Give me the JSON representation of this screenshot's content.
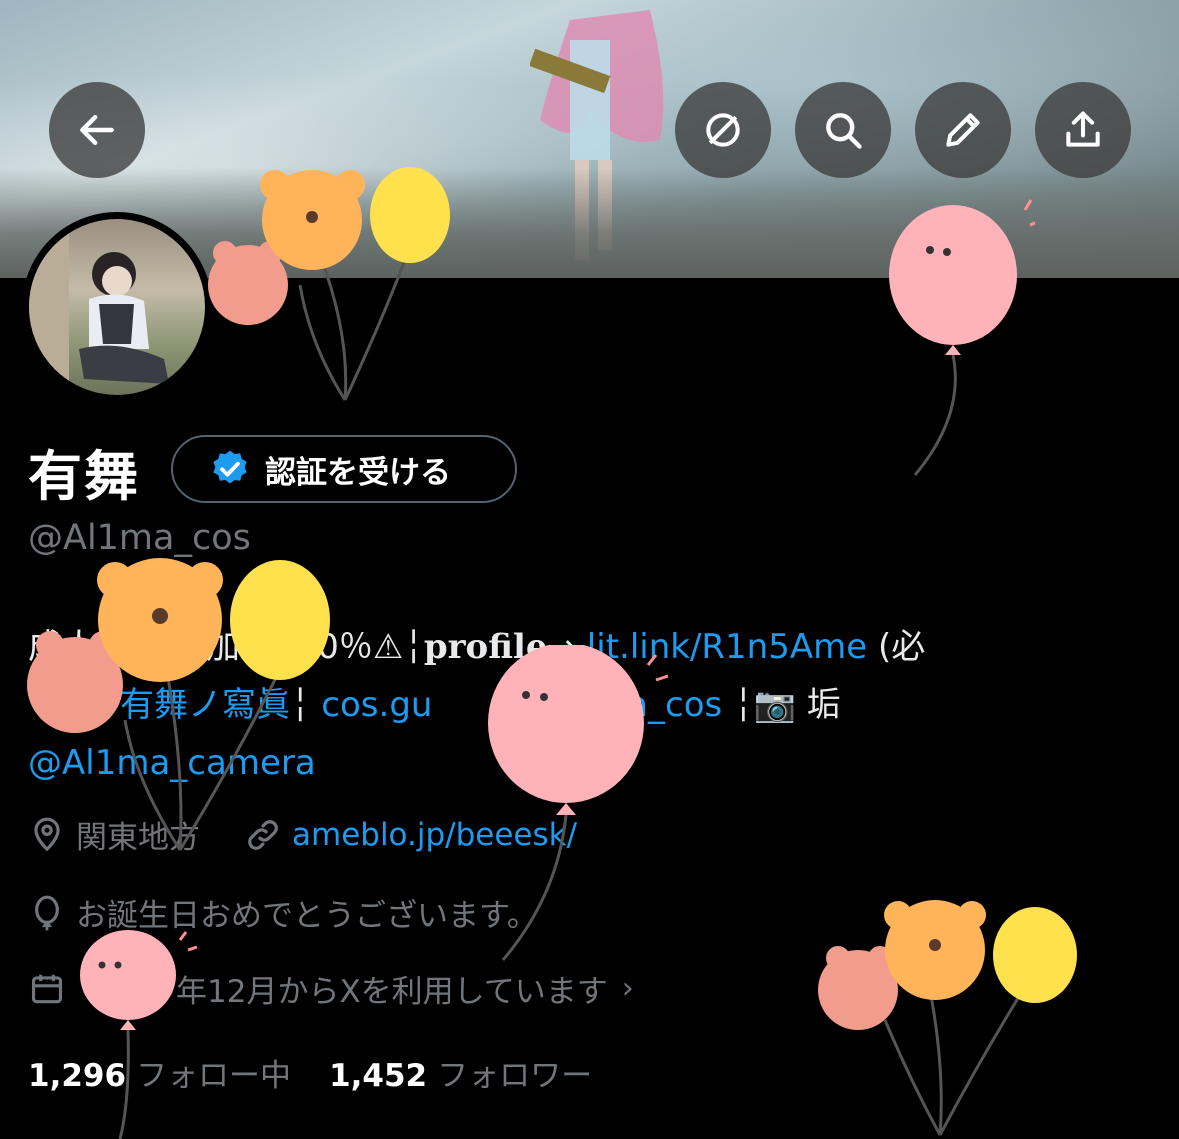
{
  "header": {
    "back_icon": "arrow-left-icon",
    "actions": [
      "circle-slash-icon",
      "search-icon",
      "pencil-icon",
      "share-icon"
    ]
  },
  "profile": {
    "display_name": "有舞",
    "verify_button": "認証を受ける",
    "handle": "@Al1ma_cos",
    "bio": {
      "line1_a": "成人",
      "line1_b": "加工100％⚠︎╎",
      "line1_profile": "profile",
      "line1_arrow": "⇢ ",
      "line1_link": "lit.link/R1n5Ame",
      "line1_c": " (必",
      "line2_link_a": "有舞ノ寫眞",
      "line2_sep1": "╎",
      "line2_link_b": "cos.gu",
      "line2_link_c": "1ma_cos",
      "line2_sep2": "╎📷 垢",
      "line3_link": "@Al1ma_camera"
    },
    "location": "関東地方",
    "website": "ameblo.jp/beeesk/",
    "birthday": "お誕生日おめでとうございます。",
    "joined": "年12月からXを利用しています",
    "following_count": "1,296",
    "following_label": "フォロー中",
    "followers_count": "1,452",
    "followers_label": "フォロワー"
  },
  "colors": {
    "background": "#000000",
    "link": "#1d9bf0",
    "muted": "#71767b",
    "verified": "#1d9bf0"
  }
}
